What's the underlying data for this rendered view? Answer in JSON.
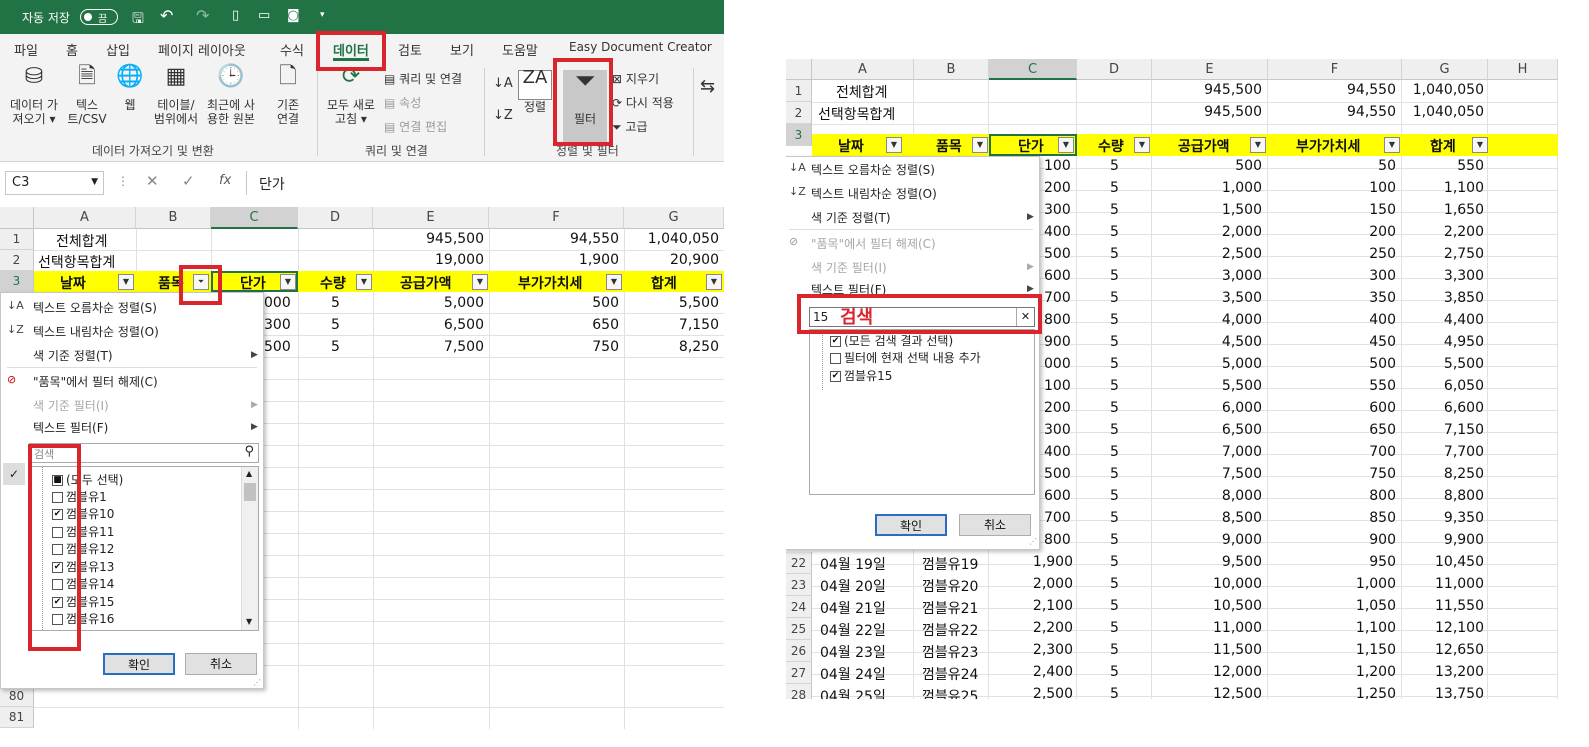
{
  "left": {
    "titlebar": {
      "autosave_label": "자동 저장",
      "toggle_label": "끔"
    },
    "tabs": [
      "파일",
      "홈",
      "삽입",
      "페이지 레이아웃",
      "수식",
      "데이터",
      "검토",
      "보기",
      "도움말",
      "Easy Document Creator"
    ],
    "ribbon": {
      "get_data": "데이터 가\n져오기 ▾",
      "text_csv": "텍스\n트/CSV",
      "web": "웹",
      "table_range": "테이블/\n범위에서",
      "recent": "최근에 사\n용한 원본",
      "existing": "기존\n연결",
      "refresh_all": "모두 새로\n고침 ▾",
      "queries_conn": "쿼리 및 연결",
      "properties": "속성",
      "edit_links": "연결 편집",
      "sort": "정렬",
      "filter": "필터",
      "clear": "지우기",
      "reapply": "다시 적용",
      "advanced": "고급",
      "group1": "데이터 가져오기 및 변환",
      "group2": "쿼리 및 연결",
      "group3": "정렬 및 필터"
    },
    "name_box": "C3",
    "formula_value": "단가",
    "col_headers": [
      "A",
      "B",
      "C",
      "D",
      "E",
      "F",
      "G"
    ],
    "row1": {
      "a": "전체합계",
      "e": "945,500",
      "f": "94,550",
      "g": "1,040,050"
    },
    "row2": {
      "a": "선택항목합계",
      "e": "19,000",
      "f": "1,900",
      "g": "20,900"
    },
    "headers": [
      "날짜",
      "품목",
      "단가",
      "수량",
      "공급가액",
      "부가가치세",
      "합계"
    ],
    "visible_rows": [
      {
        "c": "000",
        "d": "5",
        "e": "5,000",
        "f": "500",
        "g": "5,500"
      },
      {
        "c": "300",
        "d": "5",
        "e": "6,500",
        "f": "650",
        "g": "7,150"
      },
      {
        "c": "500",
        "d": "5",
        "e": "7,500",
        "f": "750",
        "g": "8,250"
      }
    ],
    "row_numbers": [
      "1",
      "2",
      "3",
      "80",
      "81"
    ],
    "menu": {
      "sort_asc": "텍스트 오름차순 정렬(S)",
      "sort_desc": "텍스트 내림차순 정렬(O)",
      "color_sort": "색 기준 정렬(T)",
      "clear_filter": "\"품목\"에서 필터 해제(C)",
      "color_filter": "색 기준 필터(I)",
      "text_filter": "텍스트 필터(F)",
      "search_placeholder": "검색",
      "items": [
        {
          "label": "(모두 선택)",
          "mark": "■"
        },
        {
          "label": "껌블유1",
          "mark": ""
        },
        {
          "label": "껌블유10",
          "mark": "✔"
        },
        {
          "label": "껌블유11",
          "mark": ""
        },
        {
          "label": "껌블유12",
          "mark": ""
        },
        {
          "label": "껌블유13",
          "mark": "✔"
        },
        {
          "label": "껌블유14",
          "mark": ""
        },
        {
          "label": "껌블유15",
          "mark": "✔"
        },
        {
          "label": "껌블유16",
          "mark": ""
        }
      ],
      "ok": "확인",
      "cancel": "취소"
    }
  },
  "right": {
    "col_headers": [
      "A",
      "B",
      "C",
      "D",
      "E",
      "F",
      "G",
      "H"
    ],
    "row1": {
      "a": "전체합계",
      "e": "945,500",
      "f": "94,550",
      "g": "1,040,050"
    },
    "row2": {
      "a": "선택항목합계",
      "e": "945,500",
      "f": "94,550",
      "g": "1,040,050"
    },
    "headers": [
      "날짜",
      "품목",
      "단가",
      "수량",
      "공급가액",
      "부가가치세",
      "합계"
    ],
    "rows_partial": [
      {
        "c": "100",
        "d": "5",
        "e": "500",
        "f": "50",
        "g": "550"
      },
      {
        "c": "200",
        "d": "5",
        "e": "1,000",
        "f": "100",
        "g": "1,100"
      },
      {
        "c": "300",
        "d": "5",
        "e": "1,500",
        "f": "150",
        "g": "1,650"
      },
      {
        "c": "400",
        "d": "5",
        "e": "2,000",
        "f": "200",
        "g": "2,200"
      },
      {
        "c": "500",
        "d": "5",
        "e": "2,500",
        "f": "250",
        "g": "2,750"
      },
      {
        "c": "600",
        "d": "5",
        "e": "3,000",
        "f": "300",
        "g": "3,300"
      },
      {
        "c": "700",
        "d": "5",
        "e": "3,500",
        "f": "350",
        "g": "3,850"
      },
      {
        "c": "800",
        "d": "5",
        "e": "4,000",
        "f": "400",
        "g": "4,400"
      },
      {
        "c": "900",
        "d": "5",
        "e": "4,500",
        "f": "450",
        "g": "4,950"
      },
      {
        "c": "000",
        "d": "5",
        "e": "5,000",
        "f": "500",
        "g": "5,500"
      },
      {
        "c": "100",
        "d": "5",
        "e": "5,500",
        "f": "550",
        "g": "6,050"
      },
      {
        "c": "200",
        "d": "5",
        "e": "6,000",
        "f": "600",
        "g": "6,600"
      },
      {
        "c": "300",
        "d": "5",
        "e": "6,500",
        "f": "650",
        "g": "7,150"
      },
      {
        "c": "400",
        "d": "5",
        "e": "7,000",
        "f": "700",
        "g": "7,700"
      },
      {
        "c": "500",
        "d": "5",
        "e": "7,500",
        "f": "750",
        "g": "8,250"
      },
      {
        "c": "600",
        "d": "5",
        "e": "8,000",
        "f": "800",
        "g": "8,800"
      },
      {
        "c": "700",
        "d": "5",
        "e": "8,500",
        "f": "850",
        "g": "9,350"
      },
      {
        "c": "800",
        "d": "5",
        "e": "9,000",
        "f": "900",
        "g": "9,900"
      }
    ],
    "rows_full": [
      {
        "n": "22",
        "a": "04월 19일",
        "b": "껌블유19",
        "c": "1,900",
        "d": "5",
        "e": "9,500",
        "f": "950",
        "g": "10,450"
      },
      {
        "n": "23",
        "a": "04월 20일",
        "b": "껌블유20",
        "c": "2,000",
        "d": "5",
        "e": "10,000",
        "f": "1,000",
        "g": "11,000"
      },
      {
        "n": "24",
        "a": "04월 21일",
        "b": "껌블유21",
        "c": "2,100",
        "d": "5",
        "e": "10,500",
        "f": "1,050",
        "g": "11,550"
      },
      {
        "n": "25",
        "a": "04월 22일",
        "b": "껌블유22",
        "c": "2,200",
        "d": "5",
        "e": "11,000",
        "f": "1,100",
        "g": "12,100"
      },
      {
        "n": "26",
        "a": "04월 23일",
        "b": "껌블유23",
        "c": "2,300",
        "d": "5",
        "e": "11,500",
        "f": "1,150",
        "g": "12,650"
      },
      {
        "n": "27",
        "a": "04월 24일",
        "b": "껌블유24",
        "c": "2,400",
        "d": "5",
        "e": "12,000",
        "f": "1,200",
        "g": "13,200"
      },
      {
        "n": "28",
        "a": "04월 25일",
        "b": "껌블유25",
        "c": "2,500",
        "d": "5",
        "e": "12,500",
        "f": "1,250",
        "g": "13,750"
      }
    ],
    "menu": {
      "sort_asc": "텍스트 오름차순 정렬(S)",
      "sort_desc": "텍스트 내림차순 정렬(O)",
      "color_sort": "색 기준 정렬(T)",
      "clear_filter": "\"품목\"에서 필터 해제(C)",
      "color_filter": "색 기준 필터(I)",
      "text_filter": "텍스트 필터(F)",
      "search_value": "15",
      "annotation": "검색",
      "items": [
        {
          "label": "(모든 검색 결과 선택)",
          "mark": "✔"
        },
        {
          "label": "필터에 현재 선택 내용 추가",
          "mark": ""
        },
        {
          "label": "껌블유15",
          "mark": "✔"
        }
      ],
      "ok": "확인",
      "cancel": "취소"
    }
  },
  "colors": {
    "excel_green": "#217346",
    "header_yellow": "#ffff00",
    "highlight_red": "#d9252b"
  }
}
